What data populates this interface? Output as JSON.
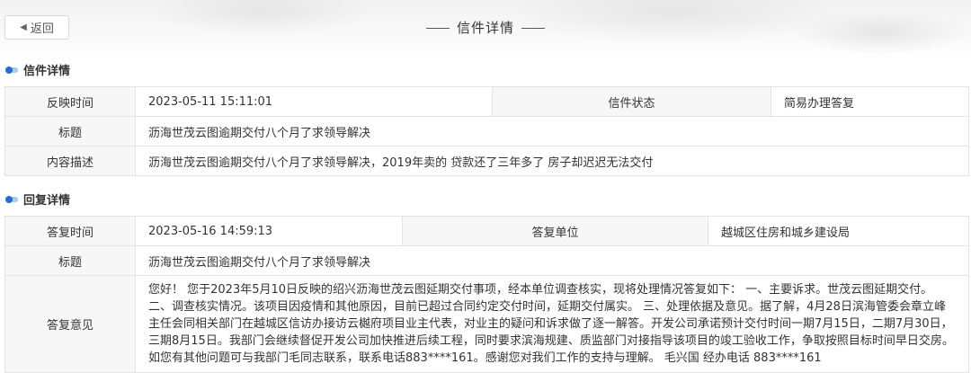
{
  "back_label": "返回",
  "page_title": "信件详情",
  "letter": {
    "section_title": "信件详情",
    "time_label": "反映时间",
    "time_value": "2023-05-11 15:11:01",
    "status_label": "信件状态",
    "status_value": "简易办理答复",
    "title_label": "标题",
    "title_value": "沥海世茂云图逾期交付八个月了求领导解决",
    "content_label": "内容描述",
    "content_value": "沥海世茂云图逾期交付八个月了求领导解决，2019年卖的 贷款还了三年多了 房子却迟迟无法交付"
  },
  "reply": {
    "section_title": "回复详情",
    "time_label": "答复时间",
    "time_value": "2023-05-16 14:59:13",
    "unit_label": "答复单位",
    "unit_value": "越城区住房和城乡建设局",
    "title_label": "标题",
    "title_value": "沥海世茂云图逾期交付八个月了求领导解决",
    "opinion_label": "答复意见",
    "opinion_value": "您好！ 您于2023年5月10日反映的绍兴沥海世茂云图延期交付事项，经本单位调查核实，现将处理情况答复如下： 一、主要诉求。世茂云图延期交付。 二、调查核实情况。该项目因疫情和其他原因，目前已超过合同约定交付时间，延期交付属实。 三、处理依据及意见。据了解，4月28日滨海管委会章立峰主任会同相关部门在越城区信访办接访云樾府项目业主代表，对业主的疑问和诉求做了逐一解答。开发公司承诺预计交付时间一期7月15日，二期7月30日，三期8月15日。我部门会继续督促开发公司加快推进后续工程，同时要求滨海规建、质监部门对接指导该项目的竣工验收工作，争取按照目标时间早日交房。如您有其他问题可与我部门毛同志联系，联系电话883****161。感谢您对我们工作的支持与理解。 毛兴国 经办电话 883****161"
  }
}
